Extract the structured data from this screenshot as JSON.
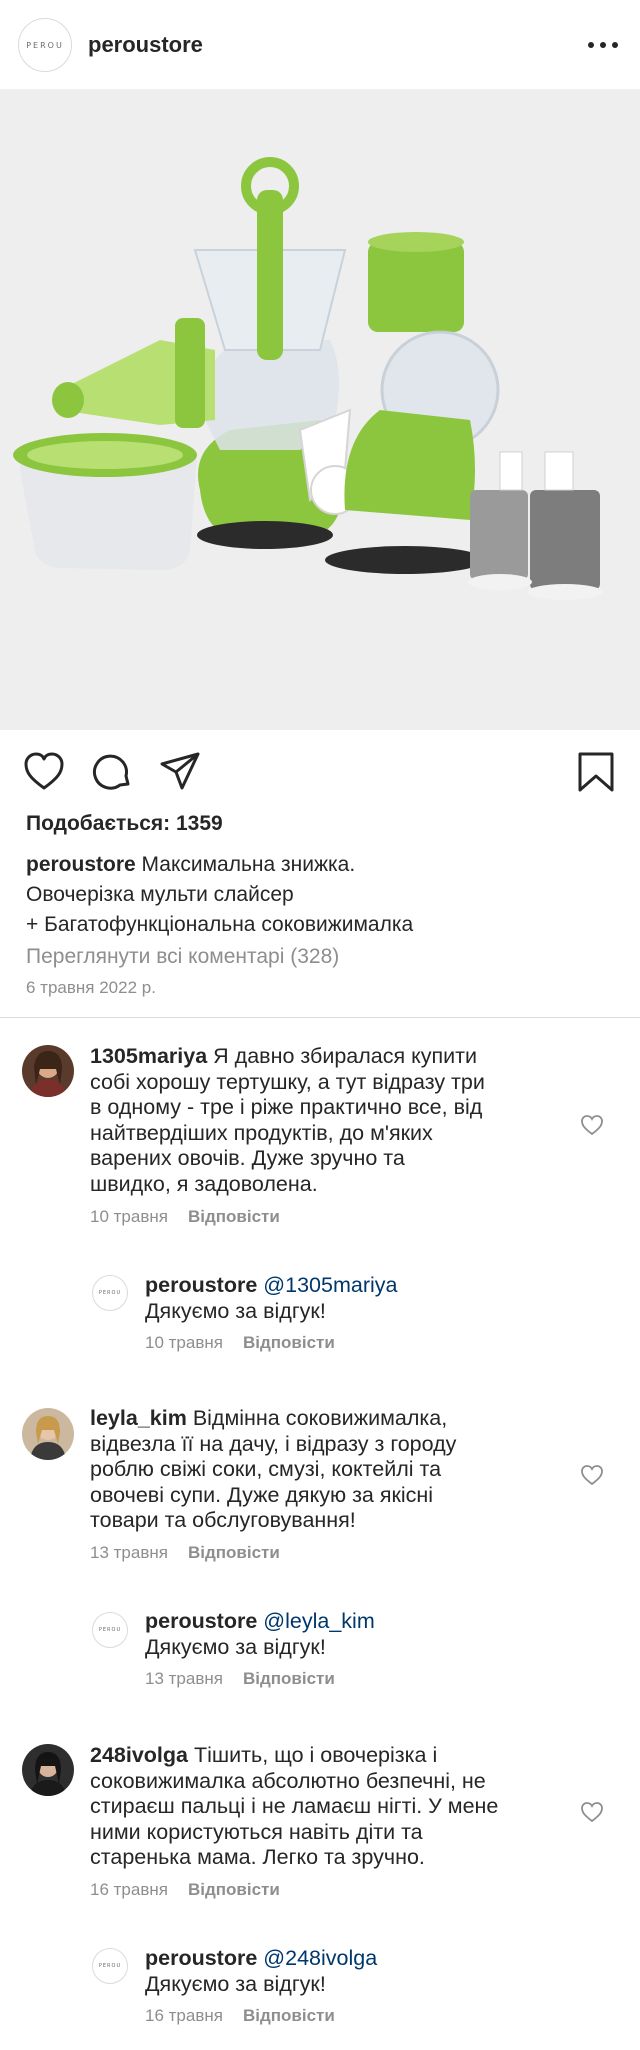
{
  "header": {
    "avatar_logo_text": "PEROU",
    "username": "peroustore"
  },
  "post": {
    "image_alt_icon": "juicer-and-slicer-product-photo",
    "likes_text": "Подобається: 1359",
    "caption_username": "peroustore",
    "caption_lines": [
      "Максимальна знижка.",
      "Овочерізка мульти слайсер",
      "+ Багатофункціональна соковижималка"
    ],
    "view_all_comments": "Переглянути всі коментарі (328)",
    "date": "6 травня 2022 р."
  },
  "comments": [
    {
      "username": "1305mariya",
      "lines": [
        "Я давно збиралася купити",
        "собі хорошу тертушку, а тут відразу три",
        "в одному - тре і ріже практично все, від",
        "найтвердіших продуктів, до м'яких",
        "варених овочів. Дуже зручно та",
        "швидко, я задоволена."
      ],
      "date": "10 травня",
      "reply_label": "Відповісти",
      "reply": {
        "username": "peroustore",
        "mention": "@1305mariya",
        "text": "Дякуємо за відгук!",
        "date": "10 травня",
        "reply_label": "Відповісти"
      }
    },
    {
      "username": "leyla_kim",
      "lines": [
        "Відмінна соковижималка,",
        "відвезла її на дачу, і відразу з городу",
        "роблю свіжі соки, смузі, коктейлі та",
        "овочеві супи. Дуже дякую за якісні",
        "товари та обслуговування!"
      ],
      "date": "13 травня",
      "reply_label": "Відповісти",
      "reply": {
        "username": "peroustore",
        "mention": "@leyla_kim",
        "text": "Дякуємо за відгук!",
        "date": "13 травня",
        "reply_label": "Відповісти"
      }
    },
    {
      "username": "248ivolga",
      "lines": [
        "Тішить, що і овочерізка і",
        "соковижималка абсолютно безпечні, не",
        "стираєш пальці і не ламаєш нігті. У мене",
        "ними користуються навіть діти та",
        "старенька мама. Легко та зручно."
      ],
      "date": "16 травня",
      "reply_label": "Відповісти",
      "reply": {
        "username": "peroustore",
        "mention": "@248ivolga",
        "text": "Дякуємо за відгук!",
        "date": "16 травня",
        "reply_label": "Відповісти"
      }
    }
  ],
  "colors": {
    "text": "#262626",
    "secondary": "#8e8e8e",
    "mention": "#00376b",
    "product_green": "#8cc63f"
  }
}
